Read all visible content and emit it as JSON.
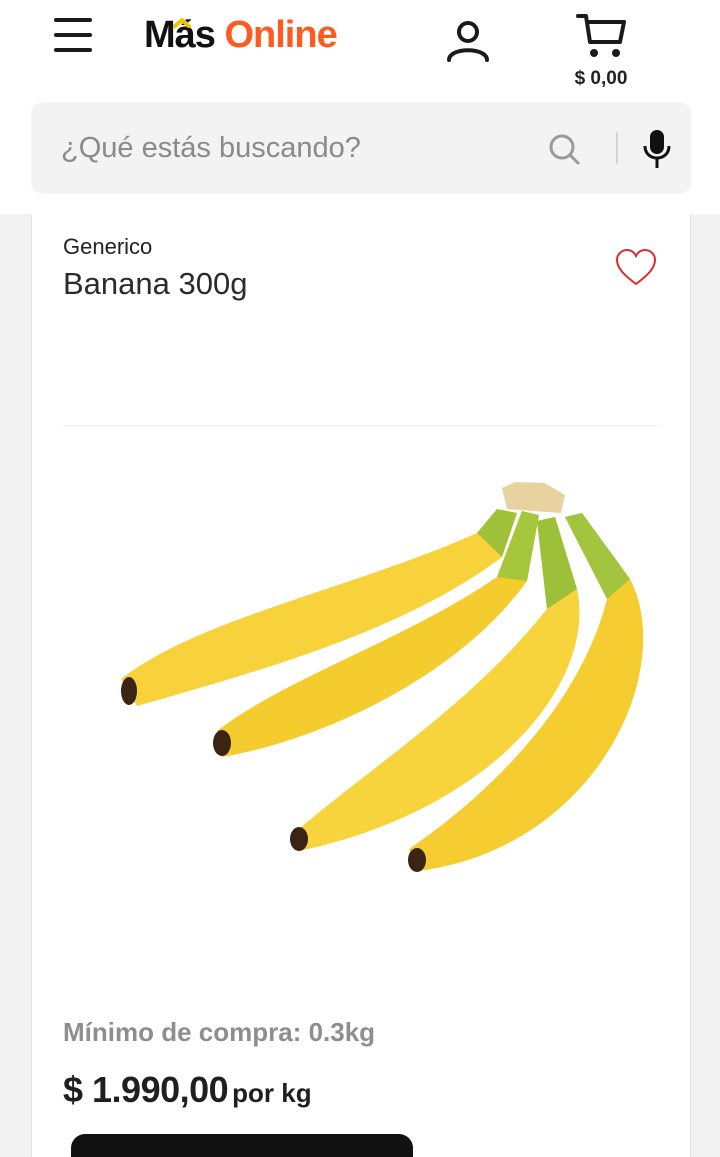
{
  "header": {
    "logo_mas": "Más",
    "logo_online": "Online",
    "cart_total": "$ 0,00",
    "accent_color": "#ff5a1f",
    "logo_chevron_color": "#f5c400"
  },
  "search": {
    "placeholder": "¿Qué estás buscando?",
    "value": ""
  },
  "product": {
    "brand": "Generico",
    "name": "Banana 300g",
    "image_icon": "banana-bunch-image",
    "min_purchase": "Mínimo de compra: 0.3kg",
    "price": "$ 1.990,00",
    "price_unit": "por kg",
    "favorite_color": "#e02b2b"
  }
}
